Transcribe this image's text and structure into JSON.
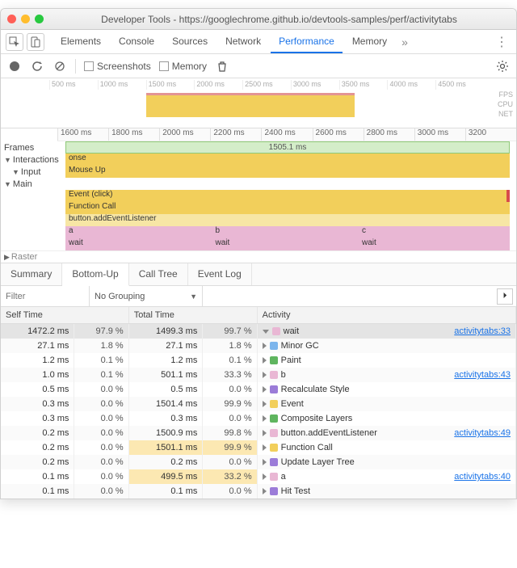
{
  "window": {
    "title": "Developer Tools - https://googlechrome.github.io/devtools-samples/perf/activitytabs"
  },
  "panels": {
    "tabs": [
      "Elements",
      "Console",
      "Sources",
      "Network",
      "Performance",
      "Memory"
    ],
    "active": "Performance",
    "more": "»"
  },
  "toolbar": {
    "screenshots_label": "Screenshots",
    "memory_label": "Memory"
  },
  "overview": {
    "ticks": [
      "500 ms",
      "1000 ms",
      "1500 ms",
      "2000 ms",
      "2500 ms",
      "3000 ms",
      "3500 ms",
      "4000 ms",
      "4500 ms"
    ],
    "side_labels": [
      "FPS",
      "CPU",
      "NET"
    ]
  },
  "timeline": {
    "ticks": [
      "1600 ms",
      "1800 ms",
      "2000 ms",
      "2200 ms",
      "2400 ms",
      "2600 ms",
      "2800 ms",
      "3000 ms",
      "3200"
    ],
    "frames_label": "Frames",
    "frames_value": "1505.1 ms",
    "interactions_label": "Interactions",
    "interactions_sub": "onse",
    "input_label": "Input",
    "input_value": "Mouse Up",
    "main_label": "Main",
    "raster_label": "Raster",
    "rows": [
      {
        "label": "Event (click)",
        "color": "#f2cf5b"
      },
      {
        "label": "Function Call",
        "color": "#f2cf5b"
      },
      {
        "label": "button.addEventListener",
        "color": "#f7e6a5"
      }
    ],
    "abc": {
      "a": "a",
      "b": "b",
      "c": "c"
    },
    "wait": "wait"
  },
  "details": {
    "tabs": [
      "Summary",
      "Bottom-Up",
      "Call Tree",
      "Event Log"
    ],
    "active": "Bottom-Up",
    "filter_placeholder": "Filter",
    "grouping": "No Grouping",
    "columns": {
      "self": "Self Time",
      "total": "Total Time",
      "activity": "Activity"
    },
    "rows": [
      {
        "self_ms": "1472.2 ms",
        "self_pct": "97.9 %",
        "total_ms": "1499.3 ms",
        "total_pct": "99.7 %",
        "color": "#e9b7d4",
        "name": "wait",
        "link": "activitytabs:33",
        "selected": true,
        "open": true
      },
      {
        "self_ms": "27.1 ms",
        "self_pct": "1.8 %",
        "total_ms": "27.1 ms",
        "total_pct": "1.8 %",
        "color": "#7cb5ec",
        "name": "Minor GC"
      },
      {
        "self_ms": "1.2 ms",
        "self_pct": "0.1 %",
        "total_ms": "1.2 ms",
        "total_pct": "0.1 %",
        "color": "#5fb55f",
        "name": "Paint"
      },
      {
        "self_ms": "1.0 ms",
        "self_pct": "0.1 %",
        "total_ms": "501.1 ms",
        "total_pct": "33.3 %",
        "total_hl": true,
        "color": "#e9b7d4",
        "name": "b",
        "link": "activitytabs:43"
      },
      {
        "self_ms": "0.5 ms",
        "self_pct": "0.0 %",
        "total_ms": "0.5 ms",
        "total_pct": "0.0 %",
        "color": "#9b7cd8",
        "name": "Recalculate Style"
      },
      {
        "self_ms": "0.3 ms",
        "self_pct": "0.0 %",
        "total_ms": "1501.4 ms",
        "total_pct": "99.9 %",
        "total_hl": true,
        "color": "#f2cf5b",
        "name": "Event"
      },
      {
        "self_ms": "0.3 ms",
        "self_pct": "0.0 %",
        "total_ms": "0.3 ms",
        "total_pct": "0.0 %",
        "color": "#5fb55f",
        "name": "Composite Layers"
      },
      {
        "self_ms": "0.2 ms",
        "self_pct": "0.0 %",
        "total_ms": "1500.9 ms",
        "total_pct": "99.8 %",
        "total_hl": true,
        "color": "#e9b7d4",
        "name": "button.addEventListener",
        "link": "activitytabs:49"
      },
      {
        "self_ms": "0.2 ms",
        "self_pct": "0.0 %",
        "total_ms": "1501.1 ms",
        "total_pct": "99.9 %",
        "total_hl": true,
        "color": "#f2cf5b",
        "name": "Function Call"
      },
      {
        "self_ms": "0.2 ms",
        "self_pct": "0.0 %",
        "total_ms": "0.2 ms",
        "total_pct": "0.0 %",
        "color": "#9b7cd8",
        "name": "Update Layer Tree"
      },
      {
        "self_ms": "0.1 ms",
        "self_pct": "0.0 %",
        "total_ms": "499.5 ms",
        "total_pct": "33.2 %",
        "total_hl": true,
        "color": "#e9b7d4",
        "name": "a",
        "link": "activitytabs:40"
      },
      {
        "self_ms": "0.1 ms",
        "self_pct": "0.0 %",
        "total_ms": "0.1 ms",
        "total_pct": "0.0 %",
        "color": "#9b7cd8",
        "name": "Hit Test"
      }
    ]
  }
}
